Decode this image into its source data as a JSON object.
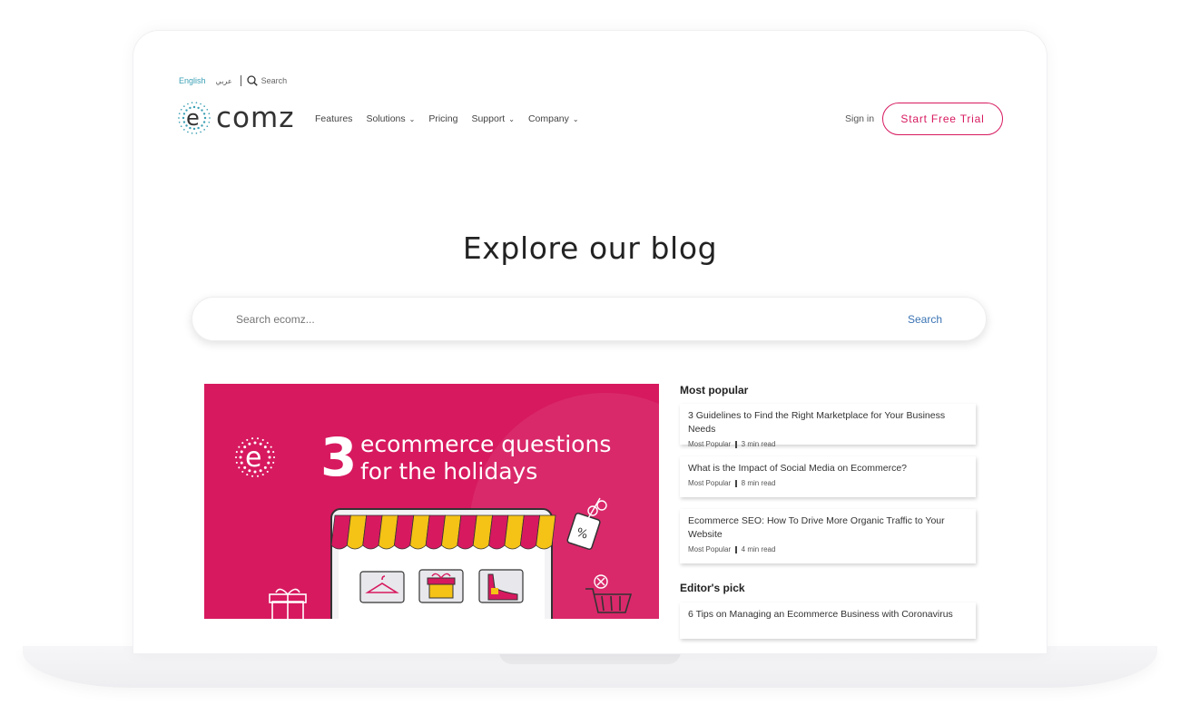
{
  "util": {
    "lang_en": "English",
    "lang_ar": "عربي",
    "search_label": "Search"
  },
  "logo": {
    "text": "comz"
  },
  "nav": {
    "items": [
      {
        "label": "Features",
        "has_dropdown": false
      },
      {
        "label": "Solutions",
        "has_dropdown": true
      },
      {
        "label": "Pricing",
        "has_dropdown": false
      },
      {
        "label": "Support",
        "has_dropdown": true
      },
      {
        "label": "Company",
        "has_dropdown": true
      }
    ],
    "signin": "Sign in",
    "trial": "Start Free Trial"
  },
  "hero": {
    "title": "Explore our blog",
    "search_placeholder": "Search ecomz...",
    "search_button": "Search"
  },
  "featured": {
    "number": "3",
    "line1": "ecommerce questions",
    "line2": "for the holidays"
  },
  "sidebar": {
    "most_popular_heading": "Most popular",
    "editors_pick_heading": "Editor's pick",
    "popular": [
      {
        "title": "3 Guidelines to Find the Right Marketplace for Your Business Needs",
        "category": "Most Popular",
        "read": "3 min read"
      },
      {
        "title": "What is the Impact of Social Media on Ecommerce?",
        "category": "Most Popular",
        "read": "8 min read"
      },
      {
        "title": "Ecommerce SEO: How To Drive More Organic Traffic to Your Website",
        "category": "Most Popular",
        "read": "4 min read"
      }
    ],
    "editors": [
      {
        "title": "6 Tips on Managing an Ecommerce Business with Coronavirus"
      }
    ]
  },
  "colors": {
    "brand": "#d7195f",
    "accent": "#3a9fb5",
    "link": "#3a73b3"
  }
}
